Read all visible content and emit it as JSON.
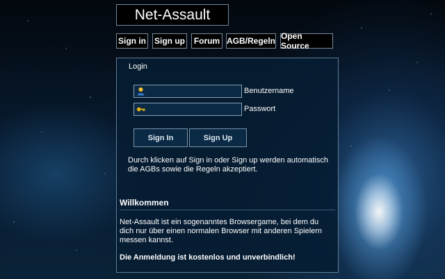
{
  "site": {
    "title": "Net-Assault"
  },
  "nav": {
    "items": [
      {
        "label": "Sign in"
      },
      {
        "label": "Sign up"
      },
      {
        "label": "Forum"
      },
      {
        "label": "AGB/Regeln"
      },
      {
        "label": "Open Source"
      }
    ]
  },
  "login": {
    "heading": "Login",
    "username": {
      "value": "",
      "label": "Benutzername",
      "icon": "user-icon"
    },
    "password": {
      "value": "",
      "label": "Passwort",
      "icon": "key-icon"
    },
    "sign_in_label": "Sign In",
    "sign_up_label": "Sign Up",
    "notice": "Durch klicken auf Sign in oder Sign up werden automatisch die AGBs sowie die Regeln akzeptiert."
  },
  "welcome": {
    "title": "Willkommen",
    "text": "Net-Assault ist ein sogenanntes Browsergame, bei dem du dich nur über einen normalen Browser mit anderen Spielern messen kannst.",
    "bold_text": "Die Anmeldung ist kostenlos und unverbindlich!"
  },
  "colors": {
    "panel_bg": "#061c32",
    "panel_border": "#5f7c95",
    "button_border": "#7a8a99",
    "text": "#ffffff"
  }
}
